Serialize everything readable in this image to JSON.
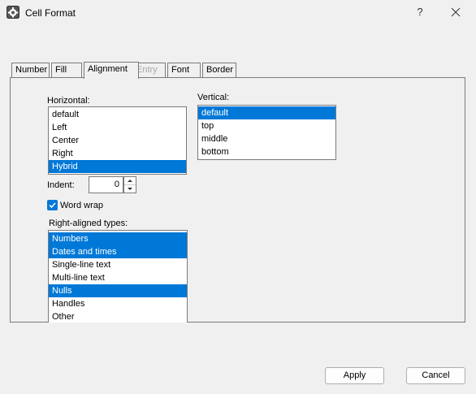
{
  "window": {
    "title": "Cell Format",
    "help_label": "?"
  },
  "tabs": [
    {
      "label": "Number"
    },
    {
      "label": "Fill"
    },
    {
      "label": "Alignment"
    },
    {
      "label": "Entry"
    },
    {
      "label": "Font"
    },
    {
      "label": "Border"
    }
  ],
  "active_tab": "Alignment",
  "alignment": {
    "horizontal": {
      "label": "Horizontal:",
      "items": [
        "default",
        "Left",
        "Center",
        "Right",
        "Hybrid"
      ],
      "selected": "Hybrid"
    },
    "vertical": {
      "label": "Vertical:",
      "items": [
        "default",
        "top",
        "middle",
        "bottom"
      ],
      "selected": "default"
    },
    "indent": {
      "label": "Indent:",
      "value": "0"
    },
    "word_wrap": {
      "label": "Word wrap",
      "checked": true
    },
    "right_aligned": {
      "label": "Right-aligned types:",
      "items": [
        "Numbers",
        "Dates and times",
        "Single-line text",
        "Multi-line text",
        "Nulls",
        "Handles",
        "Other"
      ],
      "selected": [
        "Numbers",
        "Dates and times",
        "Nulls"
      ]
    }
  },
  "buttons": {
    "apply": "Apply",
    "cancel": "Cancel"
  },
  "colors": {
    "selection": "#0078d7",
    "background": "#f0f0f0",
    "border": "#7a7a7a"
  }
}
